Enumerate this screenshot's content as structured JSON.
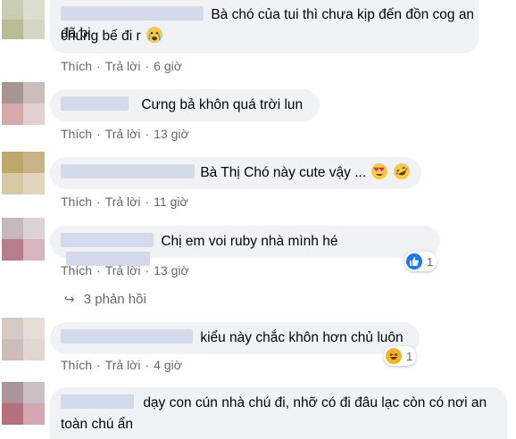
{
  "comments": [
    {
      "text_line1": "Bà chó của tui thì chưa kịp đến đồn cog an đã bị",
      "text_line2": "chúng bế đi r",
      "emoji": "crying-face",
      "actions": {
        "like": "Thích",
        "reply": "Trả lời",
        "time": "6 giờ"
      }
    },
    {
      "text": "Cưng bả khôn quá trời lun",
      "actions": {
        "like": "Thích",
        "reply": "Trả lời",
        "time": "13 giờ"
      }
    },
    {
      "text": "Bà Thị Chó này cute vậy ...",
      "emoji": [
        "heart-eyes",
        "rofl"
      ],
      "actions": {
        "like": "Thích",
        "reply": "Trả lời",
        "time": "11 giờ"
      }
    },
    {
      "text": "Chị em voi ruby nhà mình hé",
      "reaction": {
        "icon": "like-icon",
        "count": "1"
      },
      "actions": {
        "like": "Thích",
        "reply": "Trả lời",
        "time": "13 giờ"
      }
    },
    {
      "text": "kiểu này chắc khôn hơn chủ luôn",
      "reaction": {
        "icon": "haha-icon",
        "count": "1"
      },
      "actions": {
        "like": "Thích",
        "reply": "Trả lời",
        "time": "4 giờ"
      }
    },
    {
      "text_line1": "dạy con cún nhà chú đi, nhỡ có đi đâu lạc còn có nơi an",
      "text_line2": "toàn chú ẩn"
    }
  ],
  "replies_link": "3 phản hồi",
  "colors": {
    "bubble": "#f0f2f5",
    "meta": "#65676b",
    "like_blue": "#1877f2",
    "haha_yellow": "#f7b125"
  }
}
